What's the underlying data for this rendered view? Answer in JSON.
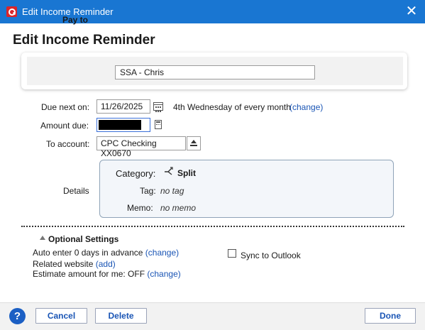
{
  "window": {
    "title": "Edit Income Reminder",
    "close_glyph": "✕"
  },
  "heading": "Edit Income Reminder",
  "pay_to": {
    "label": "Pay to",
    "value": "SSA - Chris"
  },
  "due_next": {
    "label": "Due next on:",
    "date": "11/26/2025",
    "recurrence": "4th Wednesday of every month",
    "change_link": "(change)"
  },
  "amount_due": {
    "label": "Amount due:",
    "value_redacted": true
  },
  "to_account": {
    "label": "To account:",
    "value": "CPC Checking XX0670"
  },
  "details": {
    "label": "Details",
    "category_label": "Category:",
    "category_value": "Split",
    "tag_label": "Tag:",
    "tag_value": "no tag",
    "memo_label": "Memo:",
    "memo_value": "no memo"
  },
  "optional_settings": {
    "title": "Optional Settings",
    "auto_enter_text": "Auto enter 0 days in advance",
    "auto_enter_link": "(change)",
    "related_website_text": "Related website",
    "related_website_link": "(add)",
    "estimate_text": "Estimate amount for me: OFF",
    "estimate_link": "(change)",
    "sync_label": "Sync to Outlook",
    "sync_checked": false
  },
  "footer": {
    "help_glyph": "?",
    "cancel_label": "Cancel",
    "delete_label": "Delete",
    "done_label": "Done"
  },
  "colors": {
    "titlebar": "#1976d2",
    "link": "#1a55b5",
    "app_logo": "#d9252b",
    "help_button": "#1b5fc4"
  },
  "icons": [
    "app-logo-icon",
    "close-icon",
    "calendar-icon",
    "calculator-icon",
    "account-picker-icon",
    "split-icon",
    "collapse-triangle-icon",
    "help-icon"
  ]
}
